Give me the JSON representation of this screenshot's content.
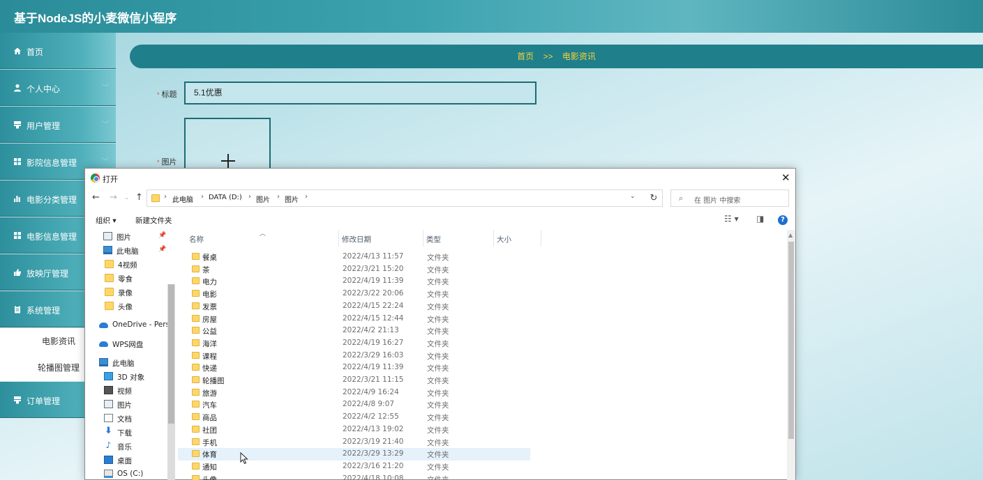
{
  "app": {
    "title": "基于NodeJS的小麦微信小程序"
  },
  "sidebar": {
    "items": [
      {
        "label": "首页",
        "icon": "home-icon",
        "has_chevron": false
      },
      {
        "label": "个人中心",
        "icon": "user-icon",
        "has_chevron": true
      },
      {
        "label": "用户管理",
        "icon": "user-manage-icon",
        "has_chevron": true
      },
      {
        "label": "影院信息管理",
        "icon": "grid-icon",
        "has_chevron": true
      },
      {
        "label": "电影分类管理",
        "icon": "bar-chart-icon",
        "has_chevron": true
      },
      {
        "label": "电影信息管理",
        "icon": "grid-icon",
        "has_chevron": true
      },
      {
        "label": "放映厅管理",
        "icon": "thumbs-up-icon",
        "has_chevron": true
      },
      {
        "label": "系统管理",
        "icon": "clipboard-icon",
        "has_chevron": true
      },
      {
        "label": "订单管理",
        "icon": "user-manage-icon",
        "has_chevron": true
      }
    ],
    "subitems": [
      {
        "label": "电影资讯"
      },
      {
        "label": "轮播图管理"
      }
    ]
  },
  "breadcrumb": {
    "home": "首页",
    "separator": ">>",
    "current": "电影资讯"
  },
  "form": {
    "title_label": "标题",
    "title_value": "5.1优惠",
    "image_label": "图片",
    "required_mark": "*"
  },
  "dialog": {
    "title": "打开",
    "path": [
      "此电脑",
      "DATA (D:)",
      "图片",
      "图片"
    ],
    "search_placeholder": "在 图片 中搜索",
    "toolbar": {
      "organize": "组织 ▾",
      "new_folder": "新建文件夹"
    },
    "columns": {
      "name": "名称",
      "modified": "修改日期",
      "type": "类型",
      "size": "大小"
    },
    "nav_items": [
      {
        "label": "图片",
        "icon": "pictures-icon",
        "pinned": true
      },
      {
        "label": "此电脑",
        "icon": "computer-icon",
        "pinned": true
      },
      {
        "label": "4视频",
        "icon": "folder-icon",
        "pinned": false
      },
      {
        "label": "零食",
        "icon": "folder-icon",
        "pinned": false
      },
      {
        "label": "录像",
        "icon": "folder-icon",
        "pinned": false
      },
      {
        "label": "头像",
        "icon": "folder-icon",
        "pinned": false
      },
      {
        "label": "OneDrive - Perso",
        "icon": "onedrive-icon",
        "pinned": false
      },
      {
        "label": "WPS网盘",
        "icon": "wps-cloud-icon",
        "pinned": false
      },
      {
        "label": "此电脑",
        "icon": "computer-icon",
        "pinned": false
      },
      {
        "label": "3D 对象",
        "icon": "3d-objects-icon",
        "pinned": false
      },
      {
        "label": "视频",
        "icon": "videos-icon",
        "pinned": false
      },
      {
        "label": "图片",
        "icon": "pictures-icon",
        "pinned": false
      },
      {
        "label": "文档",
        "icon": "documents-icon",
        "pinned": false
      },
      {
        "label": "下载",
        "icon": "download-icon",
        "pinned": false
      },
      {
        "label": "音乐",
        "icon": "music-icon",
        "pinned": false
      },
      {
        "label": "桌面",
        "icon": "desktop-icon",
        "pinned": false
      },
      {
        "label": "OS (C:)",
        "icon": "drive-icon",
        "pinned": false
      }
    ],
    "files": [
      {
        "name": "餐桌",
        "modified": "2022/4/13 11:57",
        "type": "文件夹"
      },
      {
        "name": "茶",
        "modified": "2022/3/21 15:20",
        "type": "文件夹"
      },
      {
        "name": "电力",
        "modified": "2022/4/19 11:39",
        "type": "文件夹"
      },
      {
        "name": "电影",
        "modified": "2022/3/22 20:06",
        "type": "文件夹"
      },
      {
        "name": "发票",
        "modified": "2022/4/15 22:24",
        "type": "文件夹"
      },
      {
        "name": "房屋",
        "modified": "2022/4/15 12:44",
        "type": "文件夹"
      },
      {
        "name": "公益",
        "modified": "2022/4/2 21:13",
        "type": "文件夹"
      },
      {
        "name": "海洋",
        "modified": "2022/4/19 16:27",
        "type": "文件夹"
      },
      {
        "name": "课程",
        "modified": "2022/3/29 16:03",
        "type": "文件夹"
      },
      {
        "name": "快递",
        "modified": "2022/4/19 11:39",
        "type": "文件夹"
      },
      {
        "name": "轮播图",
        "modified": "2022/3/21 11:15",
        "type": "文件夹"
      },
      {
        "name": "旅游",
        "modified": "2022/4/9 16:24",
        "type": "文件夹"
      },
      {
        "name": "汽车",
        "modified": "2022/4/8 9:07",
        "type": "文件夹"
      },
      {
        "name": "商品",
        "modified": "2022/4/2 12:55",
        "type": "文件夹"
      },
      {
        "name": "社团",
        "modified": "2022/4/13 19:02",
        "type": "文件夹"
      },
      {
        "name": "手机",
        "modified": "2022/3/19 21:40",
        "type": "文件夹"
      },
      {
        "name": "体育",
        "modified": "2022/3/29 13:29",
        "type": "文件夹",
        "selected": true
      },
      {
        "name": "通知",
        "modified": "2022/3/16 21:20",
        "type": "文件夹"
      },
      {
        "name": "头像",
        "modified": "2022/4/18 10:08",
        "type": "文件夹"
      }
    ]
  },
  "colors": {
    "accent": "#1f7f8b",
    "breadcrumb_text": "#f4d33a",
    "selected_row": "#e5f1fb"
  }
}
